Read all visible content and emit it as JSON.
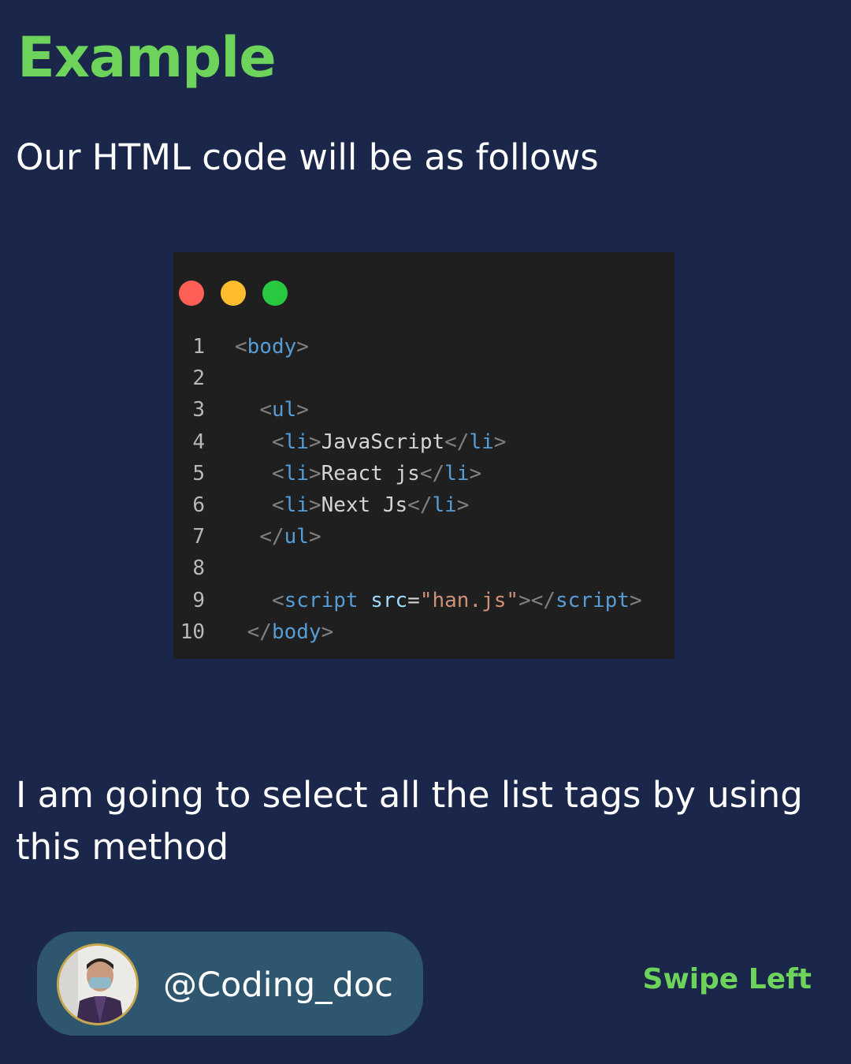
{
  "title": "Example",
  "subtitle": "Our HTML code will be as follows",
  "code_lines": [
    {
      "n": "1",
      "tokens": [
        [
          "bracket",
          "<"
        ],
        [
          "tag",
          "body"
        ],
        [
          "bracket",
          ">"
        ]
      ]
    },
    {
      "n": "2",
      "tokens": []
    },
    {
      "n": "3",
      "tokens": [
        [
          "text",
          "  "
        ],
        [
          "bracket",
          "<"
        ],
        [
          "tag",
          "ul"
        ],
        [
          "bracket",
          ">"
        ]
      ]
    },
    {
      "n": "4",
      "tokens": [
        [
          "text",
          "   "
        ],
        [
          "bracket",
          "<"
        ],
        [
          "tag",
          "li"
        ],
        [
          "bracket",
          ">"
        ],
        [
          "text",
          "JavaScript"
        ],
        [
          "bracket",
          "</"
        ],
        [
          "tag",
          "li"
        ],
        [
          "bracket",
          ">"
        ]
      ]
    },
    {
      "n": "5",
      "tokens": [
        [
          "text",
          "   "
        ],
        [
          "bracket",
          "<"
        ],
        [
          "tag",
          "li"
        ],
        [
          "bracket",
          ">"
        ],
        [
          "text",
          "React js"
        ],
        [
          "bracket",
          "</"
        ],
        [
          "tag",
          "li"
        ],
        [
          "bracket",
          ">"
        ]
      ]
    },
    {
      "n": "6",
      "tokens": [
        [
          "text",
          "   "
        ],
        [
          "bracket",
          "<"
        ],
        [
          "tag",
          "li"
        ],
        [
          "bracket",
          ">"
        ],
        [
          "text",
          "Next Js"
        ],
        [
          "bracket",
          "</"
        ],
        [
          "tag",
          "li"
        ],
        [
          "bracket",
          ">"
        ]
      ]
    },
    {
      "n": "7",
      "tokens": [
        [
          "text",
          "  "
        ],
        [
          "bracket",
          "</"
        ],
        [
          "tag",
          "ul"
        ],
        [
          "bracket",
          ">"
        ]
      ]
    },
    {
      "n": "8",
      "tokens": []
    },
    {
      "n": "9",
      "tokens": [
        [
          "text",
          "   "
        ],
        [
          "bracket",
          "<"
        ],
        [
          "tag",
          "script"
        ],
        [
          "text",
          " "
        ],
        [
          "attr",
          "src"
        ],
        [
          "eq",
          "="
        ],
        [
          "val",
          "\"han.js\""
        ],
        [
          "bracket",
          "></"
        ],
        [
          "tag",
          "script"
        ],
        [
          "bracket",
          ">"
        ]
      ]
    },
    {
      "n": "10",
      "tokens": [
        [
          "text",
          " "
        ],
        [
          "bracket",
          "</"
        ],
        [
          "tag",
          "body"
        ],
        [
          "bracket",
          ">"
        ]
      ]
    }
  ],
  "body_text": "I am going to select all the list tags by using this method",
  "profile": {
    "handle": "@Coding_doc"
  },
  "swipe_label": "Swipe Left",
  "colors": {
    "background": "#1a264a",
    "accent_green": "#6ed35a",
    "pill": "#2e566e",
    "code_bg": "#1f1f1f"
  }
}
